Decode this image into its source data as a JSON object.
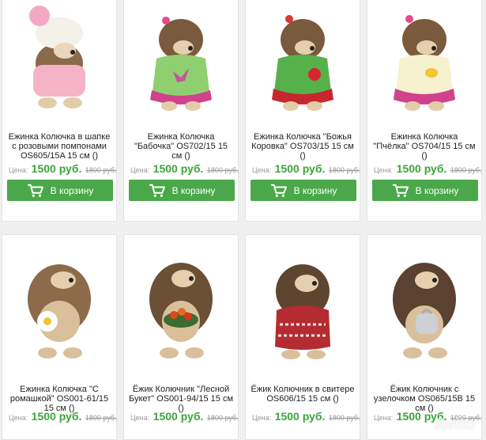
{
  "products": [
    {
      "title": "Ежинка Колючка в шапке с розовыми помпонами OS605/15A 15 см ()",
      "price_label": "Цена:",
      "price": "1500 руб.",
      "old_price": "1800 руб.",
      "button_label": "В корзину"
    },
    {
      "title": "Ежинка Колючка \"Бабочка\" OS702/15 15 см ()",
      "price_label": "Цена:",
      "price": "1500 руб.",
      "old_price": "1800 руб.",
      "button_label": "В корзину"
    },
    {
      "title": "Ежинка Колючка \"Божья Коровка\" OS703/15 15 см ()",
      "price_label": "Цена:",
      "price": "1500 руб.",
      "old_price": "1800 руб.",
      "button_label": "В корзину"
    },
    {
      "title": "Ежинка Колючка \"Пчёлка\" OS704/15 15 см ()",
      "price_label": "Цена:",
      "price": "1500 руб.",
      "old_price": "1800 руб.",
      "button_label": "В корзину"
    },
    {
      "title": "Ежинка Колючка \"С ромашкой\" OS001-61/15 15 см ()",
      "price_label": "Цена:",
      "price": "1500 руб.",
      "old_price": "1800 руб."
    },
    {
      "title": "Ёжик Колючник \"Лесной Букет\" OS001-94/15 15 см ()",
      "price_label": "Цена:",
      "price": "1500 руб.",
      "old_price": "1800 руб."
    },
    {
      "title": "Ёжик Колючник в свитере OS606/15 15 см ()",
      "price_label": "Цена:",
      "price": "1500 руб.",
      "old_price": "1800 руб."
    },
    {
      "title": "Ёжик Колючник с узелочком OS065/15B 15 см ()",
      "price_label": "Цена:",
      "price": "1500 руб.",
      "old_price": "1800 руб."
    }
  ],
  "watermark": "Avito",
  "colors": {
    "accent": "#4aa84a",
    "price": "#3aa53a",
    "background": "#f0f0f0"
  },
  "icons": {
    "cart": "cart-icon",
    "toy": "hedgehog-toy-image"
  }
}
